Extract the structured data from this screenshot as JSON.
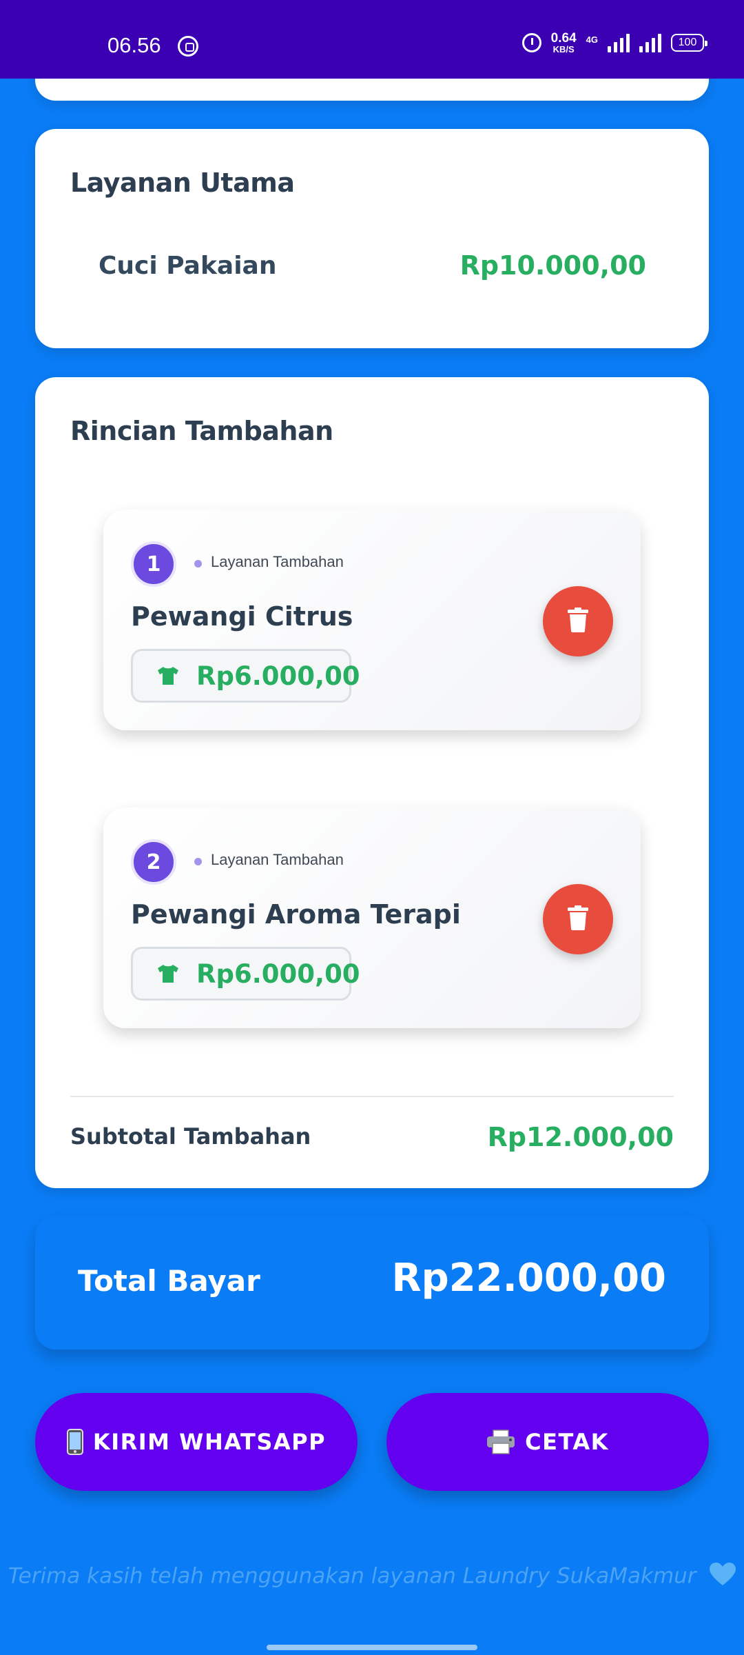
{
  "status_bar": {
    "time": "06.56",
    "net_speed_value": "0.64",
    "net_speed_unit": "KB/S",
    "network_type": "4G",
    "battery": "100"
  },
  "main_service": {
    "title": "Layanan Utama",
    "name": "Cuci Pakaian",
    "price": "Rp10.000,00"
  },
  "extras": {
    "title": "Rincian Tambahan",
    "items": [
      {
        "number": "1",
        "type": "Layanan Tambahan",
        "name": "Pewangi Citrus",
        "price": "Rp6.000,00"
      },
      {
        "number": "2",
        "type": "Layanan Tambahan",
        "name": "Pewangi Aroma Terapi",
        "price": "Rp6.000,00"
      }
    ],
    "subtotal_label": "Subtotal Tambahan",
    "subtotal_value": "Rp12.000,00"
  },
  "total": {
    "label": "Total Bayar",
    "value": "Rp22.000,00"
  },
  "actions": {
    "whatsapp_label": "KIRIM WHATSAPP",
    "print_label": "CETAK"
  },
  "footer": {
    "text": "Terima kasih telah menggunakan layanan Laundry SukaMakmur"
  },
  "colors": {
    "background": "#0a7cf5",
    "status_bar": "#3c00b3",
    "button": "#6400f0",
    "price_green": "#27ae60",
    "delete_red": "#e74c3c",
    "badge_purple": "#6c4ae0"
  },
  "icons": {
    "status_bar": [
      "whatsapp-icon",
      "alarm-icon",
      "signal-icon",
      "battery-icon"
    ],
    "item_price": "shirt-icon",
    "item_action": "trash-icon",
    "whatsapp_button": "phone-icon",
    "print_button": "printer-icon",
    "footer": "blue-heart-icon"
  }
}
